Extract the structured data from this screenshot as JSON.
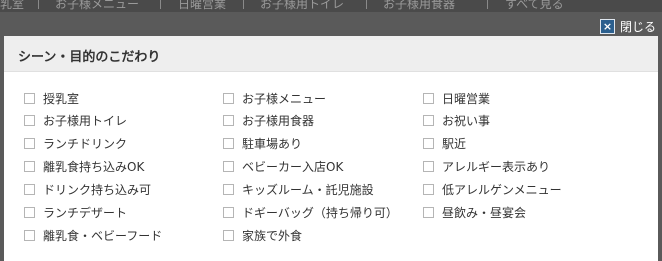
{
  "background_nav": [
    {
      "label": "乳室"
    },
    {
      "label": "お子様メニュー"
    },
    {
      "label": "日曜営業"
    },
    {
      "label": "お子様用トイレ"
    },
    {
      "label": "お子様用食器"
    },
    {
      "label": "すべて見る"
    }
  ],
  "close": {
    "label": "閉じる",
    "icon": "close-x-icon"
  },
  "modal": {
    "title": "シーン・目的のこだわり",
    "columns": [
      [
        "授乳室",
        "お子様用トイレ",
        "ランチドリンク",
        "離乳食持ち込みOK",
        "ドリンク持ち込み可",
        "ランチデザート",
        "離乳食・ベビーフード"
      ],
      [
        "お子様メニュー",
        "お子様用食器",
        "駐車場あり",
        "ベビーカー入店OK",
        "キッズルーム・託児施設",
        "ドギーバッグ（持ち帰り可）",
        "家族で外食"
      ],
      [
        "日曜営業",
        "お祝い事",
        "駅近",
        "アレルギー表示あり",
        "低アレルゲンメニュー",
        "昼飲み・昼宴会"
      ]
    ]
  },
  "colors": {
    "close_icon": "#2b5f8e",
    "overlay": "#5a5a5a",
    "header_bg": "#eeeeee"
  }
}
